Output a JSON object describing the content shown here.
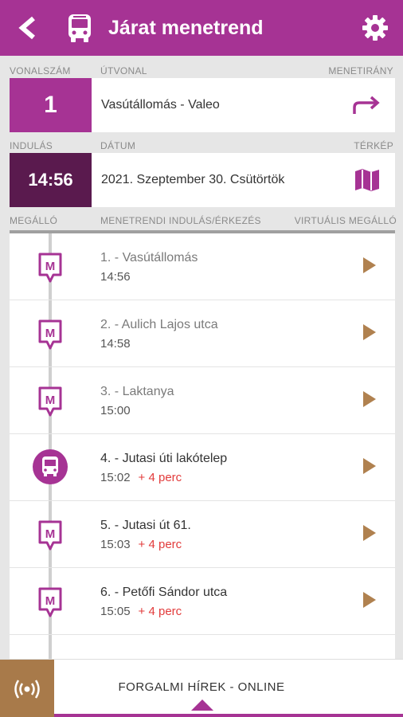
{
  "header": {
    "title": "Járat menetrend",
    "icons": {
      "back": "back-arrow-icon",
      "bus": "bus-icon",
      "settings": "gear-icon"
    }
  },
  "route_labels": {
    "line": "VONALSZÁM",
    "route": "ÚTVONAL",
    "direction": "MENETIRÁNY"
  },
  "route": {
    "line_number": "1",
    "route_name": "Vasútállomás - Valeo"
  },
  "departure_labels": {
    "departure": "INDULÁS",
    "date": "DÁTUM",
    "map": "TÉRKÉP"
  },
  "departure": {
    "time": "14:56",
    "date": "2021. Szeptember 30. Csütörtök"
  },
  "stops_labels": {
    "stop": "MEGÁLLÓ",
    "schedule": "MENETRENDI INDULÁS/ÉRKEZÉS",
    "virtual": "VIRTUÁLIS MEGÁLLÓ"
  },
  "stops": [
    {
      "name": "1. - Vasútállomás",
      "time": "14:56",
      "delay": "",
      "marker": "stop-pin-icon"
    },
    {
      "name": "2. - Aulich Lajos utca",
      "time": "14:58",
      "delay": "",
      "marker": "stop-pin-icon"
    },
    {
      "name": "3. - Laktanya",
      "time": "15:00",
      "delay": "",
      "marker": "stop-pin-icon"
    },
    {
      "name": "4. - Jutasi úti lakótelep",
      "time": "15:02",
      "delay": "+ 4 perc",
      "marker": "bus-icon"
    },
    {
      "name": "5. - Jutasi út 61.",
      "time": "15:03",
      "delay": "+ 4 perc",
      "marker": "stop-pin-icon"
    },
    {
      "name": "6. - Petőfi Sándor utca",
      "time": "15:05",
      "delay": "+ 4 perc",
      "marker": "stop-pin-icon"
    }
  ],
  "bottom": {
    "news_label": "FORGALMI HÍREK - ONLINE",
    "icon": "radio-broadcast-icon"
  },
  "colors": {
    "primary": "#a63394",
    "dark_primary": "#5a1a4e",
    "accent_brown": "#b0814f",
    "delay_red": "#e23b3b"
  }
}
